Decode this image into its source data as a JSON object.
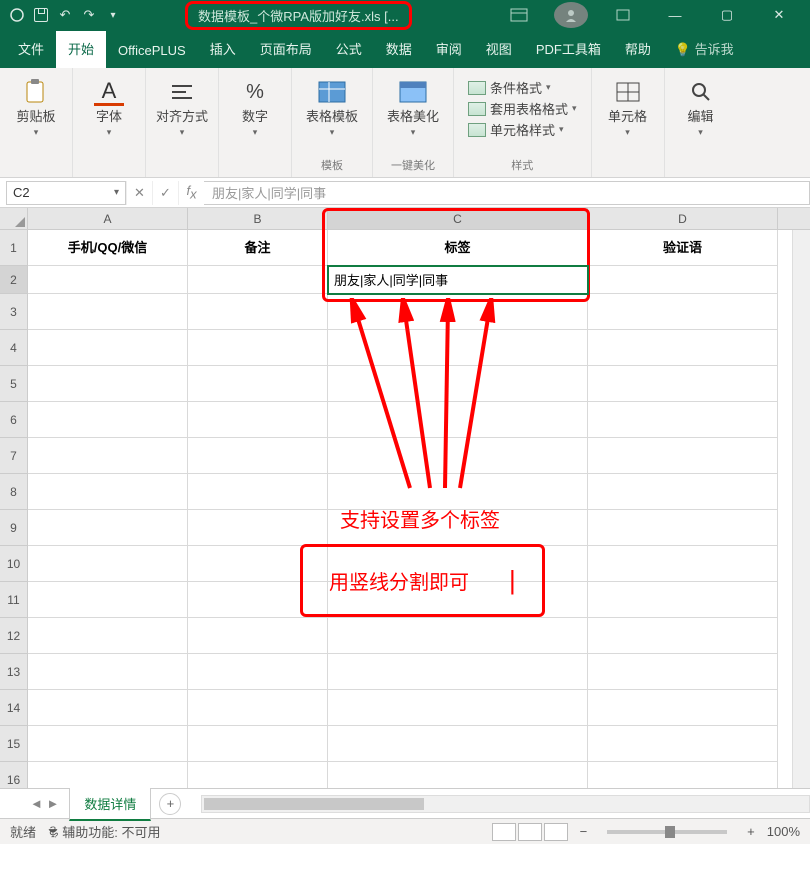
{
  "titlebar": {
    "filename": "数据模板_个微RPA版加好友.xls  [..."
  },
  "tabs": {
    "file": "文件",
    "home": "开始",
    "officeplus": "OfficePLUS",
    "insert": "插入",
    "layout": "页面布局",
    "formula": "公式",
    "data": "数据",
    "review": "审阅",
    "view": "视图",
    "pdf": "PDF工具箱",
    "help": "帮助",
    "tellme": "告诉我"
  },
  "ribbon": {
    "clipboard": "剪贴板",
    "font": "字体",
    "align": "对齐方式",
    "number": "数字",
    "template": "表格模板",
    "template_group": "模板",
    "beautify": "表格美化",
    "beautify_group": "一键美化",
    "cond_format": "条件格式",
    "table_style": "套用表格格式",
    "cell_style": "单元格样式",
    "styles_group": "样式",
    "cells": "单元格",
    "editing": "编辑"
  },
  "formula_bar": {
    "cell_ref": "C2",
    "value": "朋友|家人|同学|同事"
  },
  "columns": [
    "A",
    "B",
    "C",
    "D"
  ],
  "headers": {
    "A": "手机/QQ/微信",
    "B": "备注",
    "C": "标签",
    "D": "验证语"
  },
  "cells": {
    "C2": "朋友|家人|同学|同事"
  },
  "annotations": {
    "text1": "支持设置多个标签",
    "text2": "用竖线分割即可",
    "pipe": "|"
  },
  "sheet_tab": "数据详情",
  "status": {
    "ready": "就绪",
    "accessibility": "辅助功能: 不可用",
    "zoom": "100%"
  }
}
